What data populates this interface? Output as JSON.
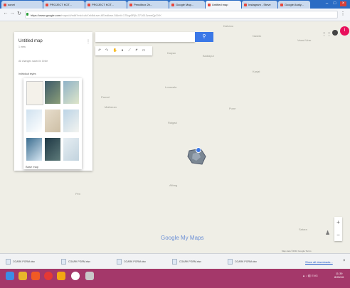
{
  "browser": {
    "tabs": [
      {
        "label": "sonet"
      },
      {
        "label": "PROJECT KOT..."
      },
      {
        "label": "PROJECT KOT..."
      },
      {
        "label": "Pencilbox 2b..."
      },
      {
        "label": "Google Map..."
      },
      {
        "label": "Untitled map"
      },
      {
        "label": "Instagram - Steve"
      },
      {
        "label": "Google Analy..."
      }
    ],
    "url_host": "https://www.google.com",
    "url_path": "/maps/d/edit?mid=zkXnl4fduwn-6Ewdkwn-5&intl=175qy0R)k-371613zweQp3YK"
  },
  "map_panel": {
    "title": "Untitled map",
    "subtitle": "1 view",
    "last_edit": "All changes saved in Drive",
    "layer_label": "Individual styles",
    "base_map_label": "Base map"
  },
  "map": {
    "places": [
      "Kalyan",
      "Badlapur",
      "Karjat",
      "Lonavala",
      "Panvel",
      "Pune",
      "Raigad",
      "Matheran",
      "Pen",
      "Dahanu",
      "Alibag",
      "Satara",
      "Vasai-Virar",
      "Nashik"
    ],
    "watermark": "Google My Maps",
    "attribution": "Map data ©2016 Google  Terms"
  },
  "colors": {
    "accent": "#3b78e7",
    "avatar": "#e8105b",
    "taskbar": "#a4386a",
    "tabstrip": "#2b6cc4"
  },
  "downloads": {
    "items": [
      {
        "name": "CGARK PGRM.xlsx"
      },
      {
        "name": "CGARK PGRM.xlsx"
      },
      {
        "name": "CGARK PGRM.xlsx"
      },
      {
        "name": "CGARK PGRM.xlsx"
      },
      {
        "name": "CGARK PGRM.xlsx"
      }
    ],
    "show_all": "Show all downloads..."
  },
  "taskbar": {
    "time": "11:39",
    "date": "8/26/16"
  }
}
